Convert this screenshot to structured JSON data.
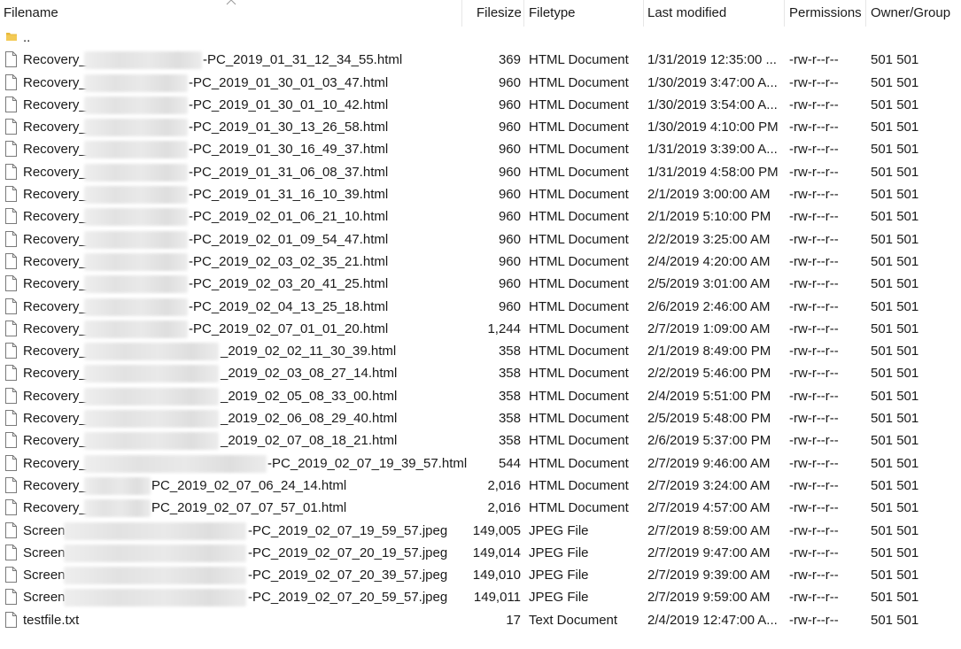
{
  "columns": {
    "filename": "Filename",
    "filesize": "Filesize",
    "filetype": "Filetype",
    "modified": "Last modified",
    "permissions": "Permissions",
    "owner": "Owner/Group"
  },
  "parent": {
    "name": ".."
  },
  "files": [
    {
      "prefix": "Recovery_",
      "suffix": "-PC_2019_01_31_12_34_55.html",
      "size": "369",
      "type": "HTML Document",
      "modified": "1/31/2019 12:35:00 ...",
      "perm": "-rw-r--r--",
      "owner": "501 501"
    },
    {
      "prefix": "Recovery_",
      "suffix": "-PC_2019_01_30_01_03_47.html",
      "size": "960",
      "type": "HTML Document",
      "modified": "1/30/2019 3:47:00 A...",
      "perm": "-rw-r--r--",
      "owner": "501 501"
    },
    {
      "prefix": "Recovery_",
      "suffix": "-PC_2019_01_30_01_10_42.html",
      "size": "960",
      "type": "HTML Document",
      "modified": "1/30/2019 3:54:00 A...",
      "perm": "-rw-r--r--",
      "owner": "501 501"
    },
    {
      "prefix": "Recovery_",
      "suffix": "-PC_2019_01_30_13_26_58.html",
      "size": "960",
      "type": "HTML Document",
      "modified": "1/30/2019 4:10:00 PM",
      "perm": "-rw-r--r--",
      "owner": "501 501"
    },
    {
      "prefix": "Recovery_",
      "suffix": "-PC_2019_01_30_16_49_37.html",
      "size": "960",
      "type": "HTML Document",
      "modified": "1/31/2019 3:39:00 A...",
      "perm": "-rw-r--r--",
      "owner": "501 501"
    },
    {
      "prefix": "Recovery_",
      "suffix": "-PC_2019_01_31_06_08_37.html",
      "size": "960",
      "type": "HTML Document",
      "modified": "1/31/2019 4:58:00 PM",
      "perm": "-rw-r--r--",
      "owner": "501 501"
    },
    {
      "prefix": "Recovery_",
      "suffix": "-PC_2019_01_31_16_10_39.html",
      "size": "960",
      "type": "HTML Document",
      "modified": "2/1/2019 3:00:00 AM",
      "perm": "-rw-r--r--",
      "owner": "501 501"
    },
    {
      "prefix": "Recovery_",
      "suffix": "-PC_2019_02_01_06_21_10.html",
      "size": "960",
      "type": "HTML Document",
      "modified": "2/1/2019 5:10:00 PM",
      "perm": "-rw-r--r--",
      "owner": "501 501"
    },
    {
      "prefix": "Recovery_",
      "suffix": "-PC_2019_02_01_09_54_47.html",
      "size": "960",
      "type": "HTML Document",
      "modified": "2/2/2019 3:25:00 AM",
      "perm": "-rw-r--r--",
      "owner": "501 501"
    },
    {
      "prefix": "Recovery_",
      "suffix": "-PC_2019_02_03_02_35_21.html",
      "size": "960",
      "type": "HTML Document",
      "modified": "2/4/2019 4:20:00 AM",
      "perm": "-rw-r--r--",
      "owner": "501 501"
    },
    {
      "prefix": "Recovery_",
      "suffix": "-PC_2019_02_03_20_41_25.html",
      "size": "960",
      "type": "HTML Document",
      "modified": "2/5/2019 3:01:00 AM",
      "perm": "-rw-r--r--",
      "owner": "501 501"
    },
    {
      "prefix": "Recovery_",
      "suffix": "-PC_2019_02_04_13_25_18.html",
      "size": "960",
      "type": "HTML Document",
      "modified": "2/6/2019 2:46:00 AM",
      "perm": "-rw-r--r--",
      "owner": "501 501"
    },
    {
      "prefix": "Recovery_",
      "suffix": "-PC_2019_02_07_01_01_20.html",
      "size": "1,244",
      "type": "HTML Document",
      "modified": "2/7/2019 1:09:00 AM",
      "perm": "-rw-r--r--",
      "owner": "501 501"
    },
    {
      "prefix": "Recovery_",
      "suffix": "_2019_02_02_11_30_39.html",
      "size": "358",
      "type": "HTML Document",
      "modified": "2/1/2019 8:49:00 PM",
      "perm": "-rw-r--r--",
      "owner": "501 501"
    },
    {
      "prefix": "Recovery_",
      "suffix": "_2019_02_03_08_27_14.html",
      "size": "358",
      "type": "HTML Document",
      "modified": "2/2/2019 5:46:00 PM",
      "perm": "-rw-r--r--",
      "owner": "501 501"
    },
    {
      "prefix": "Recovery_",
      "suffix": "_2019_02_05_08_33_00.html",
      "size": "358",
      "type": "HTML Document",
      "modified": "2/4/2019 5:51:00 PM",
      "perm": "-rw-r--r--",
      "owner": "501 501"
    },
    {
      "prefix": "Recovery_",
      "suffix": "_2019_02_06_08_29_40.html",
      "size": "358",
      "type": "HTML Document",
      "modified": "2/5/2019 5:48:00 PM",
      "perm": "-rw-r--r--",
      "owner": "501 501"
    },
    {
      "prefix": "Recovery_",
      "suffix": "_2019_02_07_08_18_21.html",
      "size": "358",
      "type": "HTML Document",
      "modified": "2/6/2019 5:37:00 PM",
      "perm": "-rw-r--r--",
      "owner": "501 501"
    },
    {
      "prefix": "Recovery_",
      "suffix": "-PC_2019_02_07_19_39_57.html",
      "size": "544",
      "type": "HTML Document",
      "modified": "2/7/2019 9:46:00 AM",
      "perm": "-rw-r--r--",
      "owner": "501 501"
    },
    {
      "prefix": "Recovery_",
      "suffix": "PC_2019_02_07_06_24_14.html",
      "size": "2,016",
      "type": "HTML Document",
      "modified": "2/7/2019 3:24:00 AM",
      "perm": "-rw-r--r--",
      "owner": "501 501"
    },
    {
      "prefix": "Recovery_",
      "suffix": "PC_2019_02_07_07_57_01.html",
      "size": "2,016",
      "type": "HTML Document",
      "modified": "2/7/2019 4:57:00 AM",
      "perm": "-rw-r--r--",
      "owner": "501 501"
    },
    {
      "prefix": "Screen",
      "suffix": "-PC_2019_02_07_19_59_57.jpeg",
      "size": "149,005",
      "type": "JPEG File",
      "modified": "2/7/2019 8:59:00 AM",
      "perm": "-rw-r--r--",
      "owner": "501 501"
    },
    {
      "prefix": "Screen",
      "suffix": "-PC_2019_02_07_20_19_57.jpeg",
      "size": "149,014",
      "type": "JPEG File",
      "modified": "2/7/2019 9:47:00 AM",
      "perm": "-rw-r--r--",
      "owner": "501 501"
    },
    {
      "prefix": "Screen",
      "suffix": "-PC_2019_02_07_20_39_57.jpeg",
      "size": "149,010",
      "type": "JPEG File",
      "modified": "2/7/2019 9:39:00 AM",
      "perm": "-rw-r--r--",
      "owner": "501 501"
    },
    {
      "prefix": "Screen",
      "suffix": "-PC_2019_02_07_20_59_57.jpeg",
      "size": "149,011",
      "type": "JPEG File",
      "modified": "2/7/2019 9:59:00 AM",
      "perm": "-rw-r--r--",
      "owner": "501 501"
    },
    {
      "prefix": "testfile.txt",
      "suffix": "",
      "size": "17",
      "type": "Text Document",
      "modified": "2/4/2019 12:47:00 A...",
      "perm": "-rw-r--r--",
      "owner": "501 501"
    }
  ],
  "colors": {
    "folder": "#e8b93a",
    "text": "#1a1a1a"
  },
  "icons": {
    "parent": "folder-icon",
    "file": "file-icon",
    "sort": "sort-ascending-icon"
  }
}
